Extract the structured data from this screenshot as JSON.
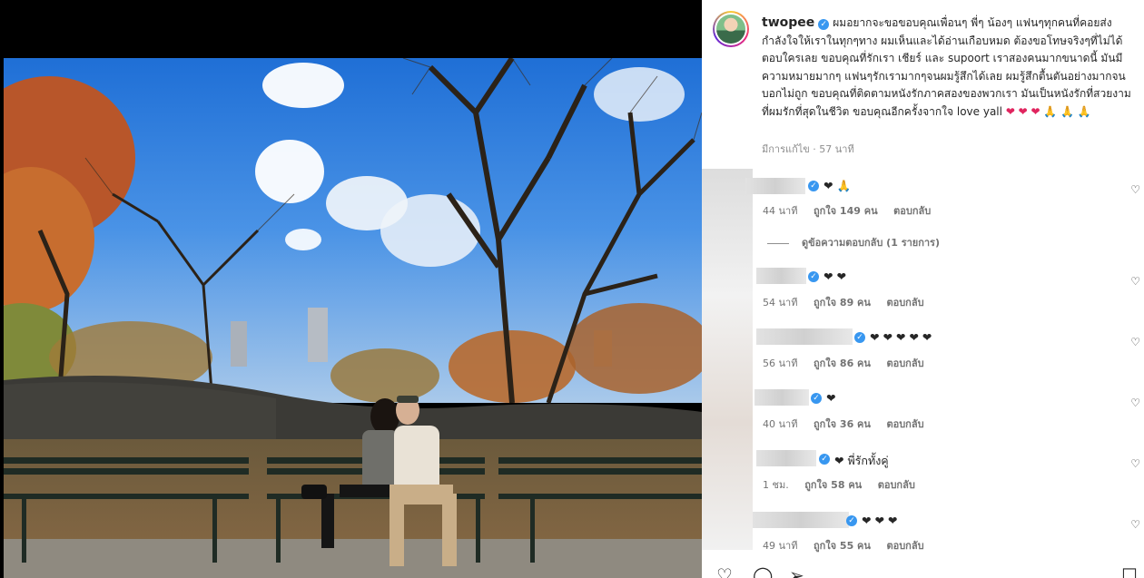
{
  "post": {
    "username": "twopee",
    "verified_mark": "✓",
    "caption": "ผมอยากจะขอขอบคุณเพื่อนๆ พี่ๆ น้องๆ แฟนๆทุกคนที่คอยส่งกำลังใจให้เราในทุกๆทาง ผมเห็นและได้อ่านเกือบหมด ต้องขอโทษจริงๆที่ไม่ได้ตอบใครเลย ขอบคุณที่รักเรา เชียร์ และ supoort เราสองคนมากขนาดนี้ มันมีความหมายมากๆ แฟนๆรักเรามากๆจนผมรู้สึกได้เลย ผมรู้สึกตื้นตันอย่างมากจนบอกไม่ถูก ขอบคุณที่ติดตามหนังรักภาคสองของพวกเรา มันเป็นหนังรักที่สวยงามที่ผมรักที่สุดในชีวิต ขอบคุณอีกครั้งจากใจ love yall",
    "caption_emoji": "❤ ❤ ❤ 🙏 🙏 🙏",
    "edited_label": "มีการแก้ไข · 57 นาที"
  },
  "view_replies": "ดูข้อความตอบกลับ (1 รายการ)",
  "reply_label": "ตอบกลับ",
  "comments": [
    {
      "text": "❤ 🙏",
      "time": "44 นาที",
      "likes": "ถูกใจ 149 คน"
    },
    {
      "text": "❤ ❤",
      "time": "54 นาที",
      "likes": "ถูกใจ 89 คน"
    },
    {
      "text": "❤ ❤ ❤ ❤ ❤",
      "time": "56 นาที",
      "likes": "ถูกใจ 86 คน"
    },
    {
      "text": "❤",
      "time": "40 นาที",
      "likes": "ถูกใจ 36 คน"
    },
    {
      "text": "❤  พี่รักทั้งคู่",
      "time": "1 ชม.",
      "likes": "ถูกใจ 58 คน"
    },
    {
      "text": "❤ ❤ ❤",
      "time": "49 นาที",
      "likes": "ถูกใจ 55 คน"
    }
  ],
  "icons": {
    "like": "♡",
    "comment": "◯",
    "share": "➢",
    "save": "☐"
  }
}
